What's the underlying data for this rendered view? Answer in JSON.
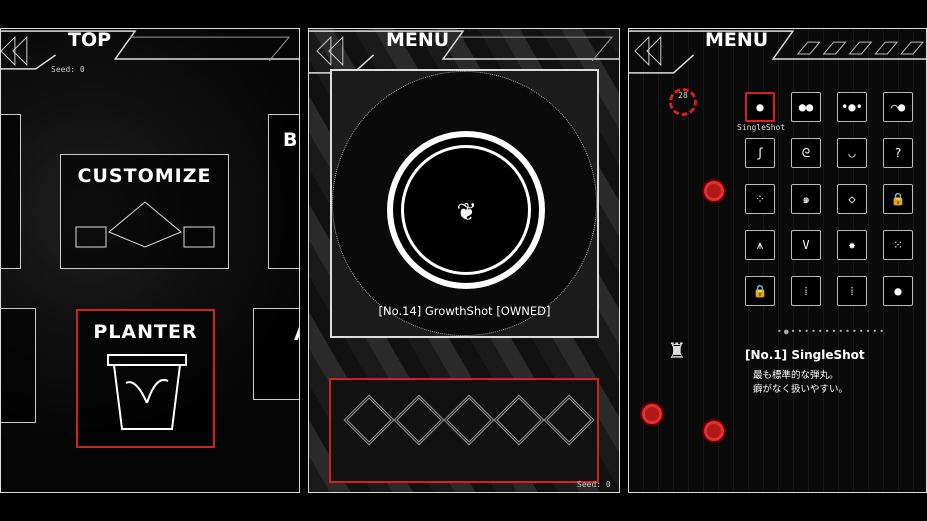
{
  "panels": [
    {
      "header": "TOP",
      "seed": "Seed: 0",
      "menu": [
        {
          "label": "CUSTOMIZE"
        },
        {
          "label": "PLANTER",
          "selected": true
        },
        {
          "label": "Bo"
        },
        {
          "label": "A"
        }
      ]
    },
    {
      "header": "MENU",
      "caption": "[No.14] GrowthShot [OWNED]",
      "seed": "Seed: 0",
      "slots": 5
    },
    {
      "header": "MENU",
      "counter": "28",
      "selected_label": "SingleShot",
      "title": "[No.1] SingleShot",
      "desc": [
        "最も標準的な弾丸。",
        "癖がなく扱いやすい。"
      ],
      "grid": [
        "●",
        "●●",
        "•●•",
        "⌒●",
        "ʃ",
        "ᘓ",
        "◡",
        "?",
        "⁘",
        "๑",
        "◇",
        "🔒",
        "⩚",
        "V",
        "✸",
        "⁙",
        "🔒",
        "⁞",
        "⁞",
        "●"
      ]
    }
  ],
  "colors": {
    "accent": "#d42020",
    "fg": "#ffffff",
    "bg": "#000000"
  }
}
